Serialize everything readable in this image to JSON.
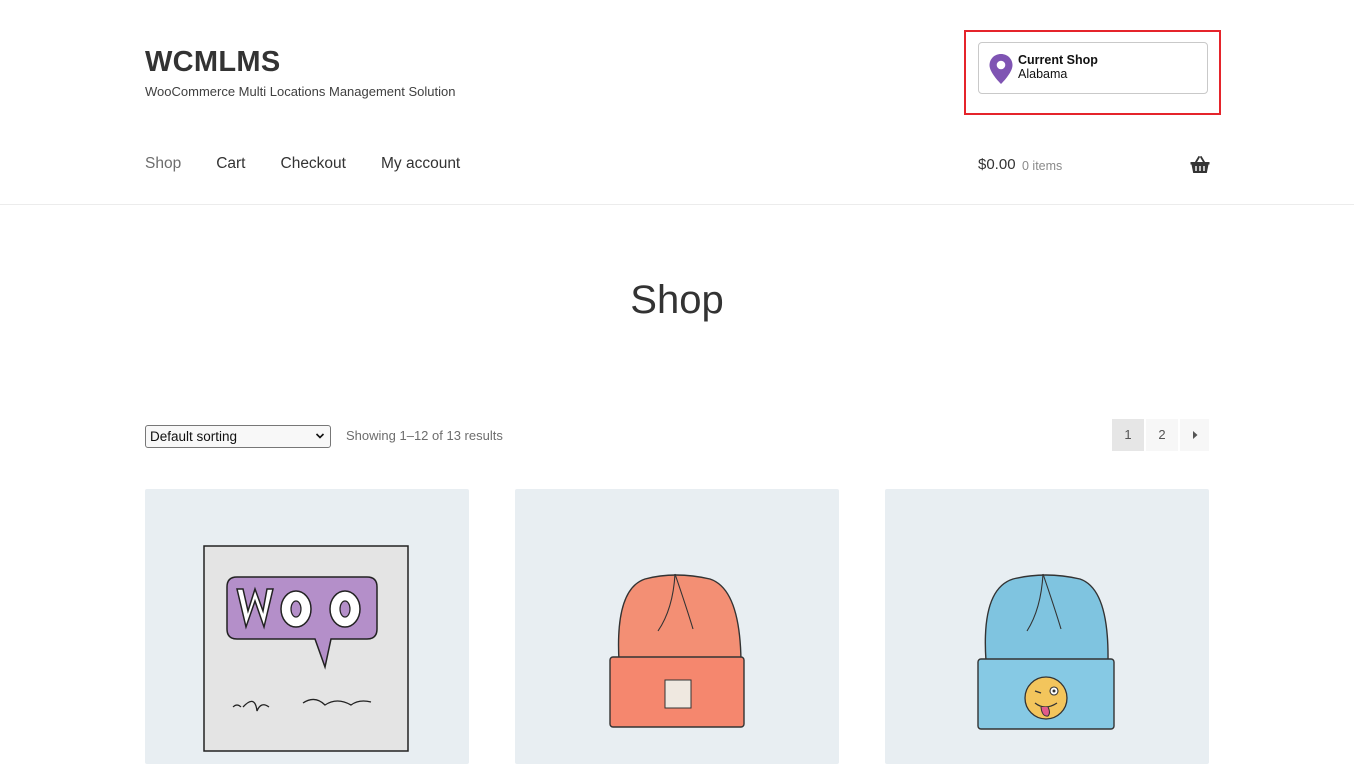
{
  "site": {
    "title": "WCMLMS",
    "description": "WooCommerce Multi Locations Management Solution"
  },
  "location_widget": {
    "label": "Current Shop",
    "value": "Alabama",
    "icon": "map-pin-icon",
    "accent": "#7f54b3",
    "highlight_color": "#e5242b"
  },
  "nav": {
    "items": [
      "Shop",
      "Cart",
      "Checkout",
      "My account"
    ],
    "current": "Shop"
  },
  "cart": {
    "total": "$0.00",
    "count": "0 items",
    "icon": "basket-icon"
  },
  "page": {
    "title": "Shop"
  },
  "toolbar": {
    "sort_selected": "Default sorting",
    "result_count": "Showing 1–12 of 13 results"
  },
  "pagination": {
    "pages": [
      "1",
      "2"
    ],
    "current": "1",
    "next_icon": "caret-right-icon"
  },
  "products": [
    {
      "image": "woo-album-cover"
    },
    {
      "image": "orange-beanie"
    },
    {
      "image": "blue-beanie-with-emoji"
    }
  ]
}
